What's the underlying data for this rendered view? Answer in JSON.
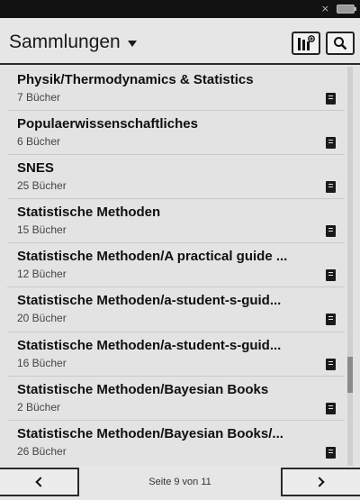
{
  "status_bar": {
    "close_glyph": "×",
    "battery_icon": "battery-icon"
  },
  "header": {
    "title": "Sammlungen",
    "dropdown_icon": "caret-down-icon",
    "manage_icon": "collection-manage-icon",
    "search_icon": "search-icon"
  },
  "collections": [
    {
      "title": "Physik/Thermodynamics & Statistics",
      "count": "7 Bücher"
    },
    {
      "title": "Populaerwissenschaftliches",
      "count": "6 Bücher"
    },
    {
      "title": "SNES",
      "count": "25 Bücher"
    },
    {
      "title": "Statistische Methoden",
      "count": "15 Bücher"
    },
    {
      "title": "Statistische Methoden/A practical guide ...",
      "count": "12 Bücher"
    },
    {
      "title": "Statistische Methoden/a-student-s-guid...",
      "count": "20 Bücher"
    },
    {
      "title": "Statistische Methoden/a-student-s-guid...",
      "count": "16 Bücher"
    },
    {
      "title": "Statistische Methoden/Bayesian Books",
      "count": "2 Bücher"
    },
    {
      "title": "Statistische Methoden/Bayesian Books/...",
      "count": "26 Bücher"
    }
  ],
  "row_icon": "document-icon",
  "footer": {
    "prev_icon": "chevron-left-icon",
    "next_icon": "chevron-right-icon",
    "page_text": "Seite 9 von 11"
  },
  "pagination": {
    "current": 9,
    "total": 11
  }
}
